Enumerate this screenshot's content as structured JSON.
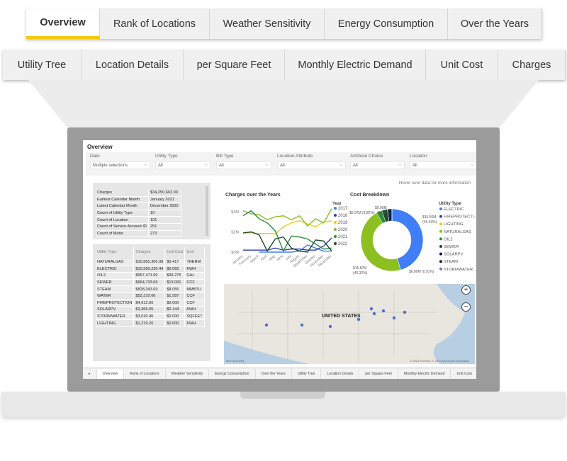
{
  "top_tabs": [
    "Overview",
    "Rank of Locations",
    "Weather Sensitivity",
    "Energy Consumption",
    "Over the Years"
  ],
  "sub_tabs": [
    "Utility Tree",
    "Location Details",
    "per Square Feet",
    "Monthly Electric Demand",
    "Unit Cost",
    "Charges"
  ],
  "report": {
    "title": "Overview",
    "filters": [
      {
        "label": "Date",
        "value": "Multiple selections"
      },
      {
        "label": "Utility Type",
        "value": "All"
      },
      {
        "label": "Bill Type",
        "value": "All"
      },
      {
        "label": "Location Attribute",
        "value": "All"
      },
      {
        "label": "Attribute Choice",
        "value": "All"
      },
      {
        "label": "Location",
        "value": "All"
      }
    ],
    "hover_hint": "Hover over data for more information",
    "summary": [
      [
        "Charges",
        "$34,250,603.90"
      ],
      [
        "Earliest Calendar Month",
        "January 2021"
      ],
      [
        "Latest Calendar Month",
        "December 2022"
      ],
      [
        "Count of Utility Type",
        "10"
      ],
      [
        "Count of Location",
        "101"
      ],
      [
        "Count of Service Account ID",
        "251"
      ],
      [
        "Count of Meter",
        "273"
      ]
    ],
    "utility_table": {
      "headers": [
        "Utility Type",
        "Charges",
        "Unit Cost",
        "Unit"
      ],
      "rows": [
        [
          "NATURALGAS",
          "$15,865,306.08",
          "$0.417",
          "THERM"
        ],
        [
          "ELECTRIC",
          "$15,560,230.44",
          "$0.065",
          "KWH"
        ],
        [
          "OIL2",
          "$967,471.60",
          "$39.275",
          "GAL"
        ],
        [
          "SEWER",
          "$964,733.66",
          "$13.091",
          "CCF"
        ],
        [
          "STEAM",
          "$828,343.69",
          "$8.055",
          "MMBTU"
        ],
        [
          "WATER",
          "$52,310.66",
          "$1.587",
          "CCF"
        ],
        [
          "FIREPROTECTION",
          "$4,612.00",
          "$0.000",
          "CCF"
        ],
        [
          "SOLARPV",
          "$3,366.05",
          "$0.144",
          "KWH"
        ],
        [
          "STORMWATER",
          "$3,010.46",
          "$0.000",
          "SQFEET"
        ],
        [
          "LIGHTING",
          "$1,219.26",
          "$0.000",
          "KWH"
        ]
      ]
    },
    "map": {
      "label": "UNITED STATES",
      "attribution": "© 2023 TomTom, © 2023 Microsoft Corporation",
      "logo": "Microsoft Bing"
    },
    "bottom_tabs": [
      "Overview",
      "Rank of Locations",
      "Weather Sensitivity",
      "Energy Consumption",
      "Over the Years",
      "Utility Tree",
      "Location Details",
      "per Square Feet",
      "Monthly Electric Demand",
      "Unit Cost"
    ]
  },
  "chart_data": [
    {
      "type": "line",
      "title": "Charges over the Years",
      "legend_title": "Year",
      "legend_placement": "right",
      "categories": [
        "January",
        "February",
        "March",
        "April",
        "May",
        "June",
        "July",
        "August",
        "September",
        "October",
        "November",
        "December"
      ],
      "yticks": [
        "$0M",
        "$2M",
        "$4M"
      ],
      "ylim": [
        0,
        4.4
      ],
      "unit": "$M",
      "series": [
        {
          "name": "2017",
          "color": "#3f7ef7",
          "values": [
            null,
            null,
            0.0,
            0.0,
            0.0,
            0.0,
            0.0,
            0.1,
            0.7,
            0.4,
            0.1,
            0.1
          ]
        },
        {
          "name": "2018",
          "color": "#2b3ea8",
          "values": [
            0.2,
            0.2,
            0.2,
            0.2,
            0.4,
            0.2,
            0.3,
            0.3,
            0.2,
            0.2,
            0.6,
            1.4
          ]
        },
        {
          "name": "2019",
          "color": "#f2c811",
          "values": [
            1.9,
            1.9,
            1.85,
            1.85,
            1.8,
            2.5,
            2.9,
            3.1,
            2.8,
            2.5,
            3.0,
            3.1
          ]
        },
        {
          "name": "2020",
          "color": "#8cbf1f",
          "values": [
            4.1,
            3.8,
            3.7,
            3.2,
            3.5,
            3.6,
            3.2,
            3.6,
            2.6,
            3.3,
            2.9,
            4.3
          ]
        },
        {
          "name": "2021",
          "color": "#2e8b3e",
          "values": [
            3.6,
            4.1,
            3.3,
            2.9,
            2.1,
            0.1,
            1.6,
            1.5,
            1.3,
            0.8,
            0.3,
            0.4
          ]
        },
        {
          "name": "2022",
          "color": "#1a4a2a",
          "values": [
            1.9,
            2.0,
            1.7,
            0.1,
            1.3,
            1.5,
            0.4,
            0.1,
            0.0,
            1.2,
            1.1,
            0.1
          ]
        }
      ]
    },
    {
      "type": "pie",
      "title": "Cost Breakdown",
      "legend_title": "Utility Type",
      "legend_placement": "right",
      "slices": [
        {
          "name": "ELECTRIC",
          "value": 45.43,
          "color": "#3f7ef7"
        },
        {
          "name": "FIREPROTECTI...",
          "value": 0.01,
          "color": "#2b3ea8"
        },
        {
          "name": "LIGHTING",
          "value": 0.0,
          "color": "#f2c811"
        },
        {
          "name": "NATURALGAS",
          "value": 46.32,
          "color": "#8cbf1f"
        },
        {
          "name": "OIL2",
          "value": 2.82,
          "color": "#2e8b3e"
        },
        {
          "name": "SEWER",
          "value": 2.82,
          "color": "#1a4a2a"
        },
        {
          "name": "SOLARPV",
          "value": 0.01,
          "color": "#0f1a4a"
        },
        {
          "name": "STEAM",
          "value": 2.42,
          "color": "#13244a"
        },
        {
          "name": "STORMWATER",
          "value": 0.01,
          "color": "#5a7fd0"
        }
      ],
      "data_labels": [
        "$15.56M",
        "(45.43%)",
        "$15.87M",
        "(46.32%)",
        "$0.97M (2.82%)",
        "(8.01%)",
        "$0.00M",
        "$0.00M (0.01%)"
      ]
    }
  ]
}
